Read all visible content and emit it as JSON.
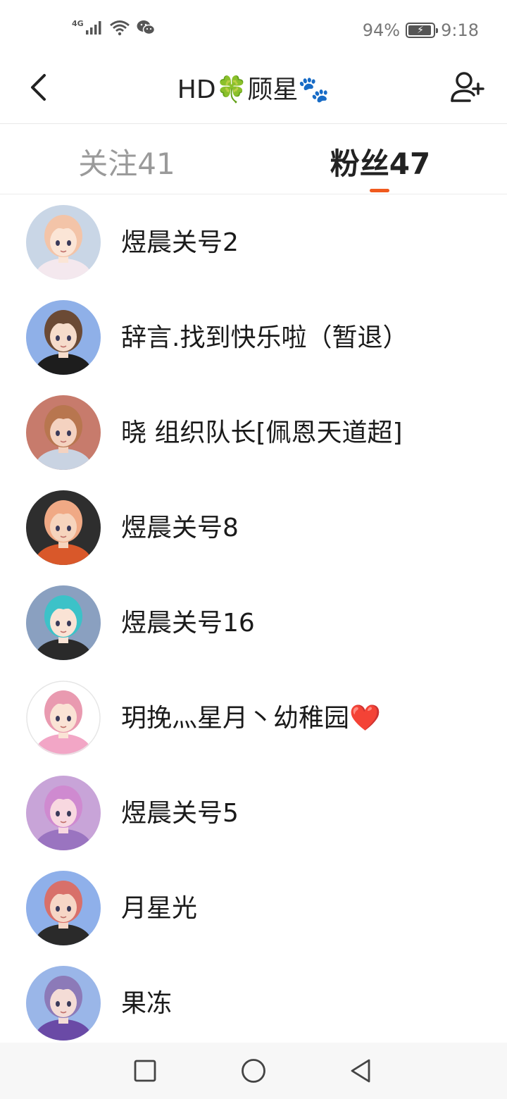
{
  "status_bar": {
    "network_label": "4G",
    "battery_percent_label": "94%",
    "battery_level": 94,
    "time": "9:18",
    "icons": [
      "signal-icon",
      "wifi-icon",
      "wechat-icon",
      "battery-icon"
    ]
  },
  "header": {
    "title": "HD🍀顾星🐾",
    "back_icon": "chevron-left-icon",
    "add_icon": "add-user-icon"
  },
  "tabs": [
    {
      "label": "关注41",
      "active": false
    },
    {
      "label": "粉丝47",
      "active": true
    }
  ],
  "accent_color": "#f05a1e",
  "fans": [
    {
      "name": "煜晨关号2",
      "avatar": {
        "bg": "#c9d6e6",
        "hair": "#f3c4a8",
        "skin": "#fbe5d6",
        "cloth": "#f4e8ee"
      }
    },
    {
      "name": "辞言.找到快乐啦（暂退）",
      "avatar": {
        "bg": "#8fb0e8",
        "hair": "#6b4a35",
        "skin": "#f6dccb",
        "cloth": "#1d1d1d"
      }
    },
    {
      "name": "晓  组织队长[佩恩天道超]",
      "avatar": {
        "bg": "#c77b6c",
        "hair": "#b8764f",
        "skin": "#f4d2c0",
        "cloth": "#c9d3e2"
      }
    },
    {
      "name": "煜晨关号8",
      "avatar": {
        "bg": "#2e2e2e",
        "hair": "#f0a985",
        "skin": "#f6d4bd",
        "cloth": "#d9582a"
      }
    },
    {
      "name": "煜晨关号16",
      "avatar": {
        "bg": "#8aa0c0",
        "hair": "#3cc2c8",
        "skin": "#fae3d5",
        "cloth": "#2a2a2a"
      }
    },
    {
      "name": "玥挽灬星月丶幼稚园❤️",
      "avatar": {
        "bg": "#ffffff",
        "hair": "#e99ab0",
        "skin": "#fae3d5",
        "cloth": "#f2a6c6"
      }
    },
    {
      "name": "煜晨关号5",
      "avatar": {
        "bg": "#c8a4d8",
        "hair": "#cf8ad0",
        "skin": "#f8d8e0",
        "cloth": "#9a74c0"
      }
    },
    {
      "name": "月星光",
      "avatar": {
        "bg": "#8fb0ea",
        "hair": "#d8706a",
        "skin": "#f6d6c6",
        "cloth": "#2a2a2a"
      }
    },
    {
      "name": "果冻",
      "avatar": {
        "bg": "#9ab6e8",
        "hair": "#8c7ab8",
        "skin": "#f4dcd6",
        "cloth": "#6a4aa6"
      }
    }
  ],
  "nav_bar": {
    "recent_icon": "square-icon",
    "home_icon": "circle-icon",
    "back_icon": "triangle-back-icon"
  }
}
